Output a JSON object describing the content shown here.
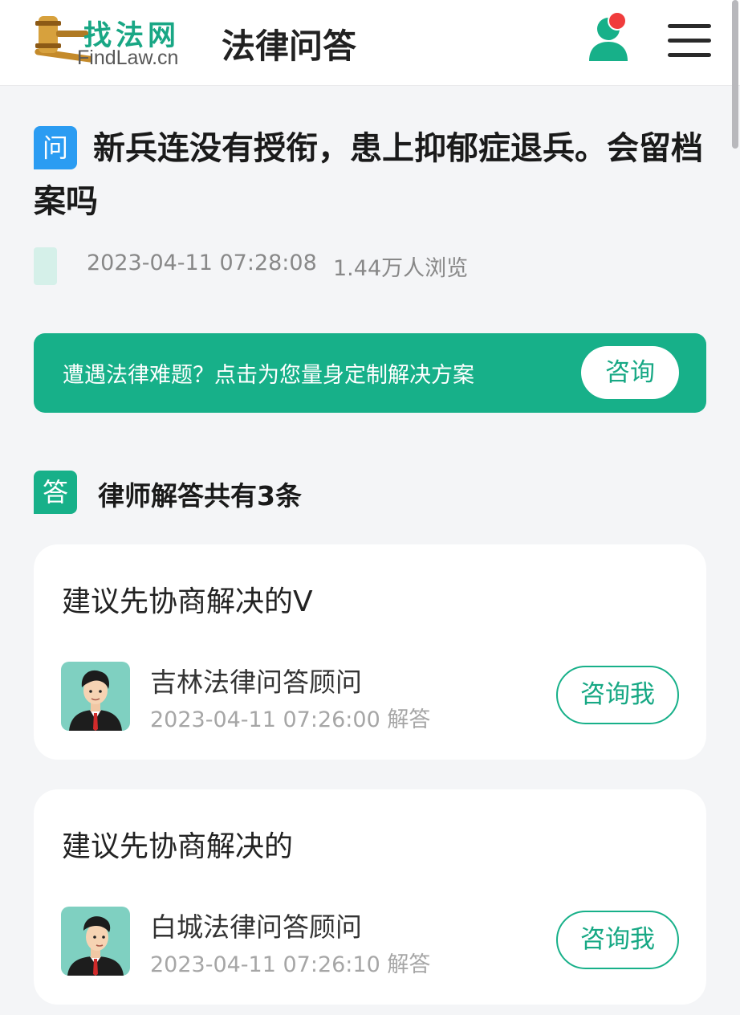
{
  "header": {
    "logo_cn": "找法网",
    "logo_en": "FindLaw.cn",
    "title": "法律问答"
  },
  "question": {
    "badge": "问",
    "title": "新兵连没有授衔，患上抑郁症退兵。会留档案吗",
    "date": "2023-04-11 07:28:08",
    "views": "1.44万人浏览"
  },
  "banner": {
    "text": "遭遇法律难题？点击为您量身定制解决方案",
    "button": "咨询"
  },
  "answers_section": {
    "badge": "答",
    "heading": "律师解答共有3条"
  },
  "answers": [
    {
      "text": "建议先协商解决的V",
      "lawyer": "吉林法律问答顾问",
      "time": "2023-04-11 07:26:00 解答",
      "button": "咨询我"
    },
    {
      "text": "建议先协商解决的",
      "lawyer": "白城法律问答顾问",
      "time": "2023-04-11 07:26:10 解答",
      "button": "咨询我"
    }
  ],
  "colors": {
    "brand_green": "#17b089",
    "question_blue": "#2b9cf2",
    "notification_red": "#f03c3c"
  },
  "icons": {
    "user": "user-icon",
    "menu": "hamburger-menu-icon",
    "logo": "gavel-logo-icon"
  }
}
